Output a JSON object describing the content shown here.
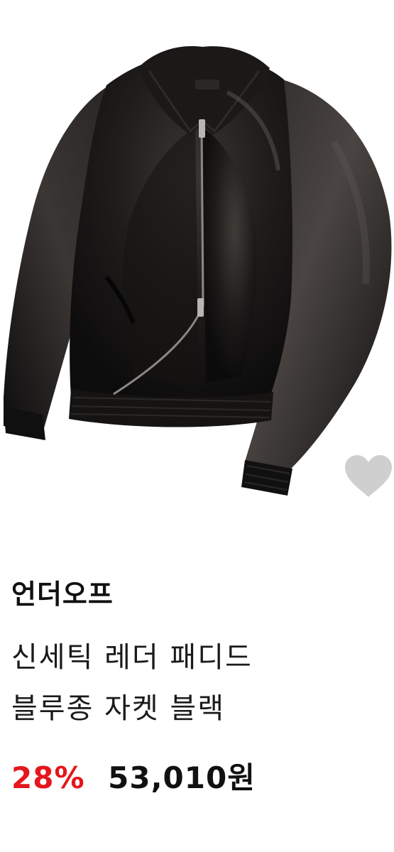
{
  "product": {
    "image_alt": "black leather bomber jacket",
    "brand": "언더오프",
    "name_lines": [
      "신세틱 레더 패디드",
      "블루종 자켓 블랙"
    ],
    "discount": "28%",
    "price": "53,010원"
  },
  "colors": {
    "discount": "#e5161c",
    "text": "#111111",
    "heart": "#cfcfcf"
  },
  "icons": {
    "wishlist": "heart-icon"
  }
}
